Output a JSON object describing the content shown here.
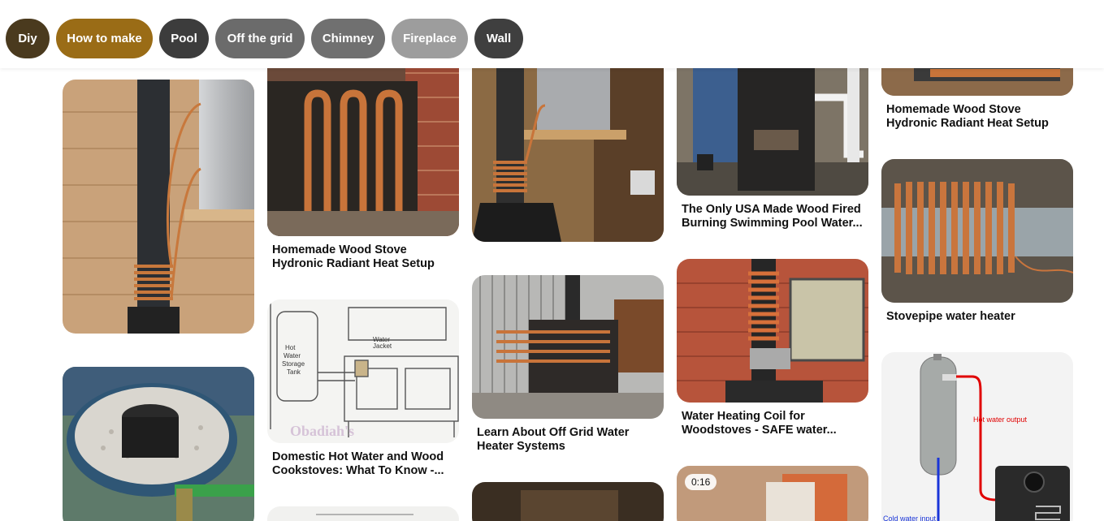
{
  "chips": [
    {
      "label": "Diy",
      "color": "#4a3a1e"
    },
    {
      "label": "How to make",
      "color": "#9a6c16"
    },
    {
      "label": "Pool",
      "color": "#3c3c3c"
    },
    {
      "label": "Off the grid",
      "color": "#6b6b6b"
    },
    {
      "label": "Chimney",
      "color": "#707070"
    },
    {
      "label": "Fireplace",
      "color": "#9d9d9d"
    },
    {
      "label": "Wall",
      "color": "#3f3f3f"
    }
  ],
  "pins": {
    "p1": {
      "title": ""
    },
    "p2": {
      "title": ""
    },
    "p3": {
      "title": "Homemade Wood Stove Hydronic Radiant Heat Setup"
    },
    "p4": {
      "title": "Domestic Hot Water and Wood Cookstoves: What To Know -..."
    },
    "p5": {
      "title": ""
    },
    "p6": {
      "title": ""
    },
    "p7": {
      "title": "Learn About Off Grid Water Heater Systems"
    },
    "p8": {
      "title": ""
    },
    "p9": {
      "title": "The Only USA Made Wood Fired Burning Swimming Pool Water..."
    },
    "p10": {
      "title": "Water Heating Coil for Woodstoves - SAFE water..."
    },
    "p11": {
      "title": "",
      "badge": "0:16"
    },
    "p12": {
      "title": "Homemade Wood Stove Hydronic Radiant Heat Setup"
    },
    "p13": {
      "title": "Stovepipe water heater"
    },
    "p14": {
      "title": ""
    }
  },
  "diagram_labels": {
    "tank": "Hot Water Storage Tank",
    "jacket": "Water Jacket",
    "watermark": "Obadiah's"
  },
  "heater_labels": {
    "hot": "Hot water output",
    "cold": "Cold water input"
  }
}
